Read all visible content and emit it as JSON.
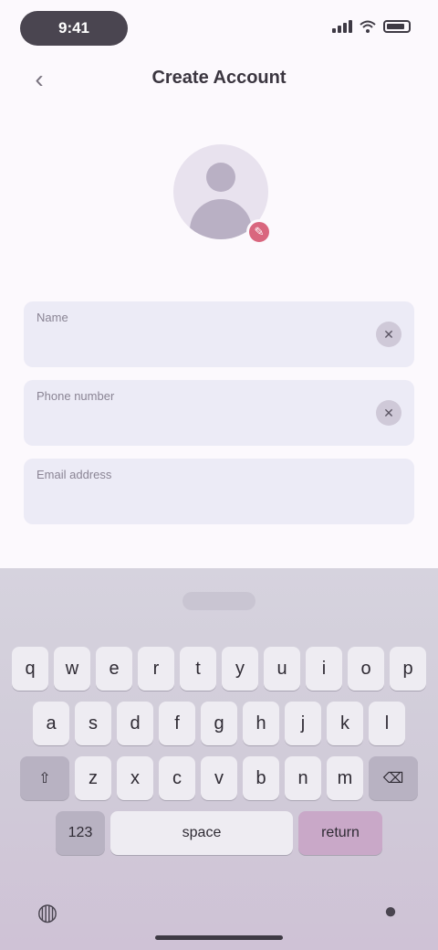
{
  "status": {
    "time": "9:41"
  },
  "header": {
    "title": "Create Account",
    "back_icon": "back-arrow-icon"
  },
  "avatar": {
    "badge_icon": "edit-pencil-icon",
    "badge_color": "#d9667e"
  },
  "form": {
    "fields": [
      {
        "label": "Name",
        "placeholder": "",
        "action_icon": "clear-icon"
      },
      {
        "label": "Phone number",
        "placeholder": "",
        "action_icon": "clear-icon"
      },
      {
        "label": "Email address",
        "placeholder": "",
        "action_icon": ""
      }
    ],
    "hint": "",
    "hint_link": ""
  },
  "keyboard": {
    "suggestion": "",
    "row1": [
      "q",
      "w",
      "e",
      "r",
      "t",
      "y",
      "u",
      "i",
      "o",
      "p"
    ],
    "row2": [
      "a",
      "s",
      "d",
      "f",
      "g",
      "h",
      "j",
      "k",
      "l"
    ],
    "row3": [
      "z",
      "x",
      "c",
      "v",
      "b",
      "n",
      "m"
    ],
    "shift_label": "⇧",
    "delete_label": "⌫",
    "numbers_label": "123",
    "space_label": "space",
    "return_label": "return"
  },
  "colors": {
    "accent": "#d9667e",
    "field_bg": "#ecebf6"
  }
}
